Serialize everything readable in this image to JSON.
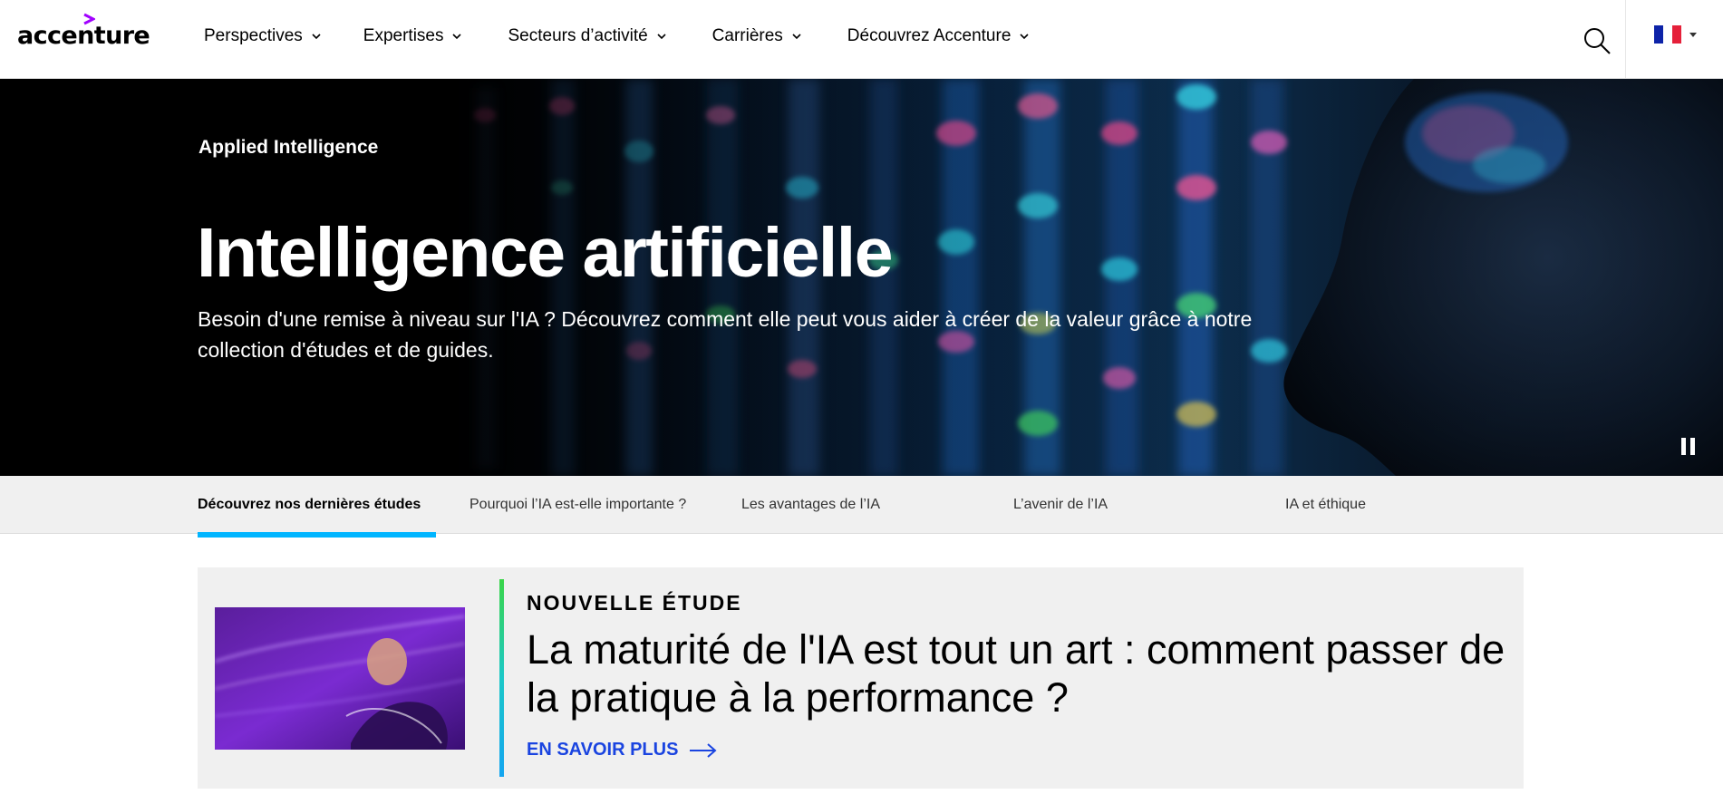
{
  "header": {
    "logo_text": "accenture",
    "nav": [
      {
        "label": "Perspectives"
      },
      {
        "label": "Expertises"
      },
      {
        "label": "Secteurs d’activité"
      },
      {
        "label": "Carrières"
      },
      {
        "label": "Découvrez Accenture"
      }
    ],
    "icons": {
      "search": "search-icon",
      "language": "france-flag-icon",
      "dropdown": "caret-down-icon"
    },
    "flag_colors": [
      "#0d23a8",
      "#ffffff",
      "#e5203a"
    ]
  },
  "hero": {
    "eyebrow": "Applied Intelligence",
    "title": "Intelligence artificielle",
    "description": "Besoin d'une remise à niveau sur l'IA ? Découvrez comment elle peut vous aider à créer de la valeur grâce à notre collection d'études et de guides.",
    "pause_icon": "pause-icon"
  },
  "subnav": {
    "items": [
      {
        "label": "Découvrez nos dernières études",
        "active": true
      },
      {
        "label": "Pourquoi l’IA est-elle importante ?"
      },
      {
        "label": "Les avantages de l’IA"
      },
      {
        "label": "L’avenir de l’IA"
      },
      {
        "label": "IA et éthique"
      }
    ],
    "active_color": "#00b5ff"
  },
  "feature": {
    "eyebrow": "NOUVELLE ÉTUDE",
    "title": "La maturité de l'IA est tout un art : comment passer de la pratique à la performance ?",
    "cta": "EN SAVOIR PLUS",
    "cta_color": "#1a44e0",
    "image_icon": "violinist-image",
    "arrow_icon": "arrow-right-icon"
  },
  "colors": {
    "brand_purple": "#a100ff",
    "accent_green": "#3ad548",
    "accent_blue": "#14a5f0"
  }
}
